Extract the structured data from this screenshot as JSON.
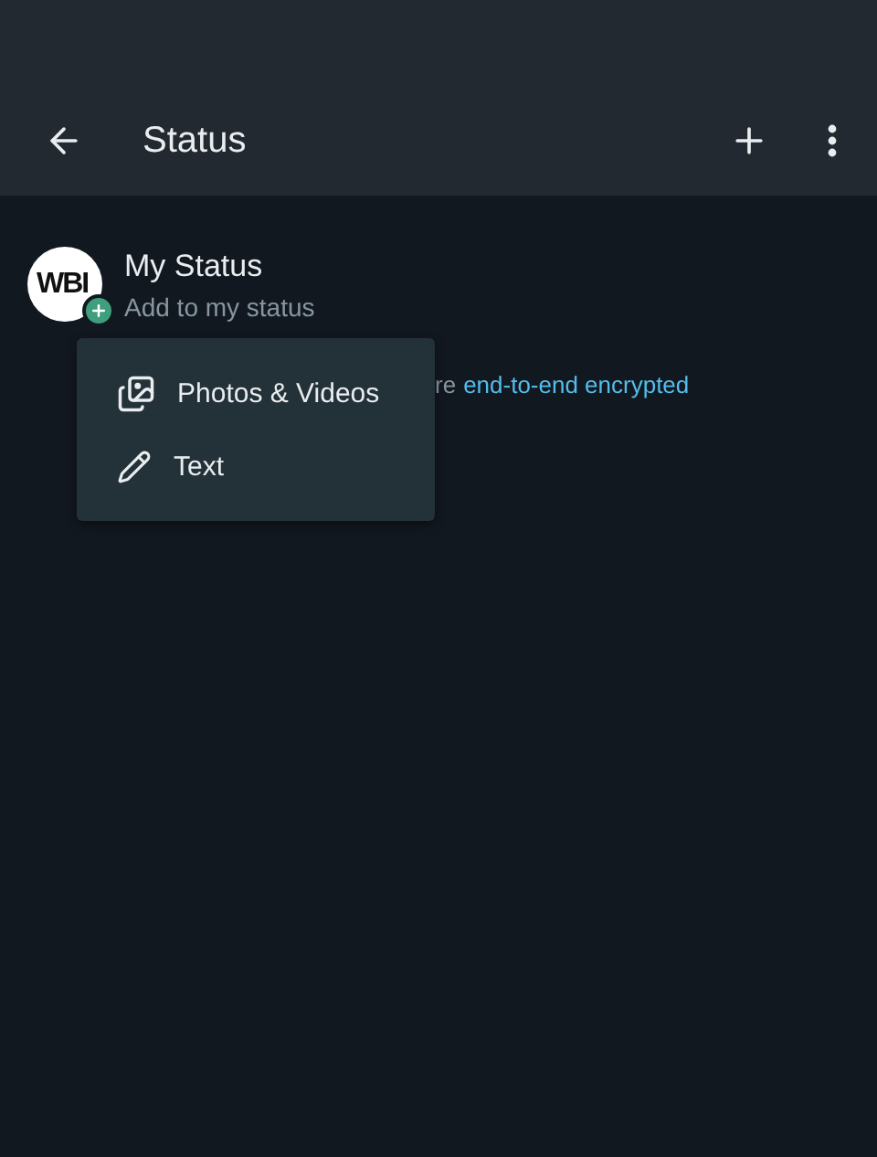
{
  "header": {
    "title": "Status"
  },
  "my_status": {
    "avatar_text": "WBI",
    "name": "My Status",
    "subtitle": "Add to my status"
  },
  "encryption_notice": {
    "text": "re",
    "link": "end-to-end encrypted"
  },
  "menu": {
    "items": [
      {
        "kind": "photos",
        "label": "Photos & Videos"
      },
      {
        "kind": "text",
        "label": "Text"
      }
    ]
  }
}
